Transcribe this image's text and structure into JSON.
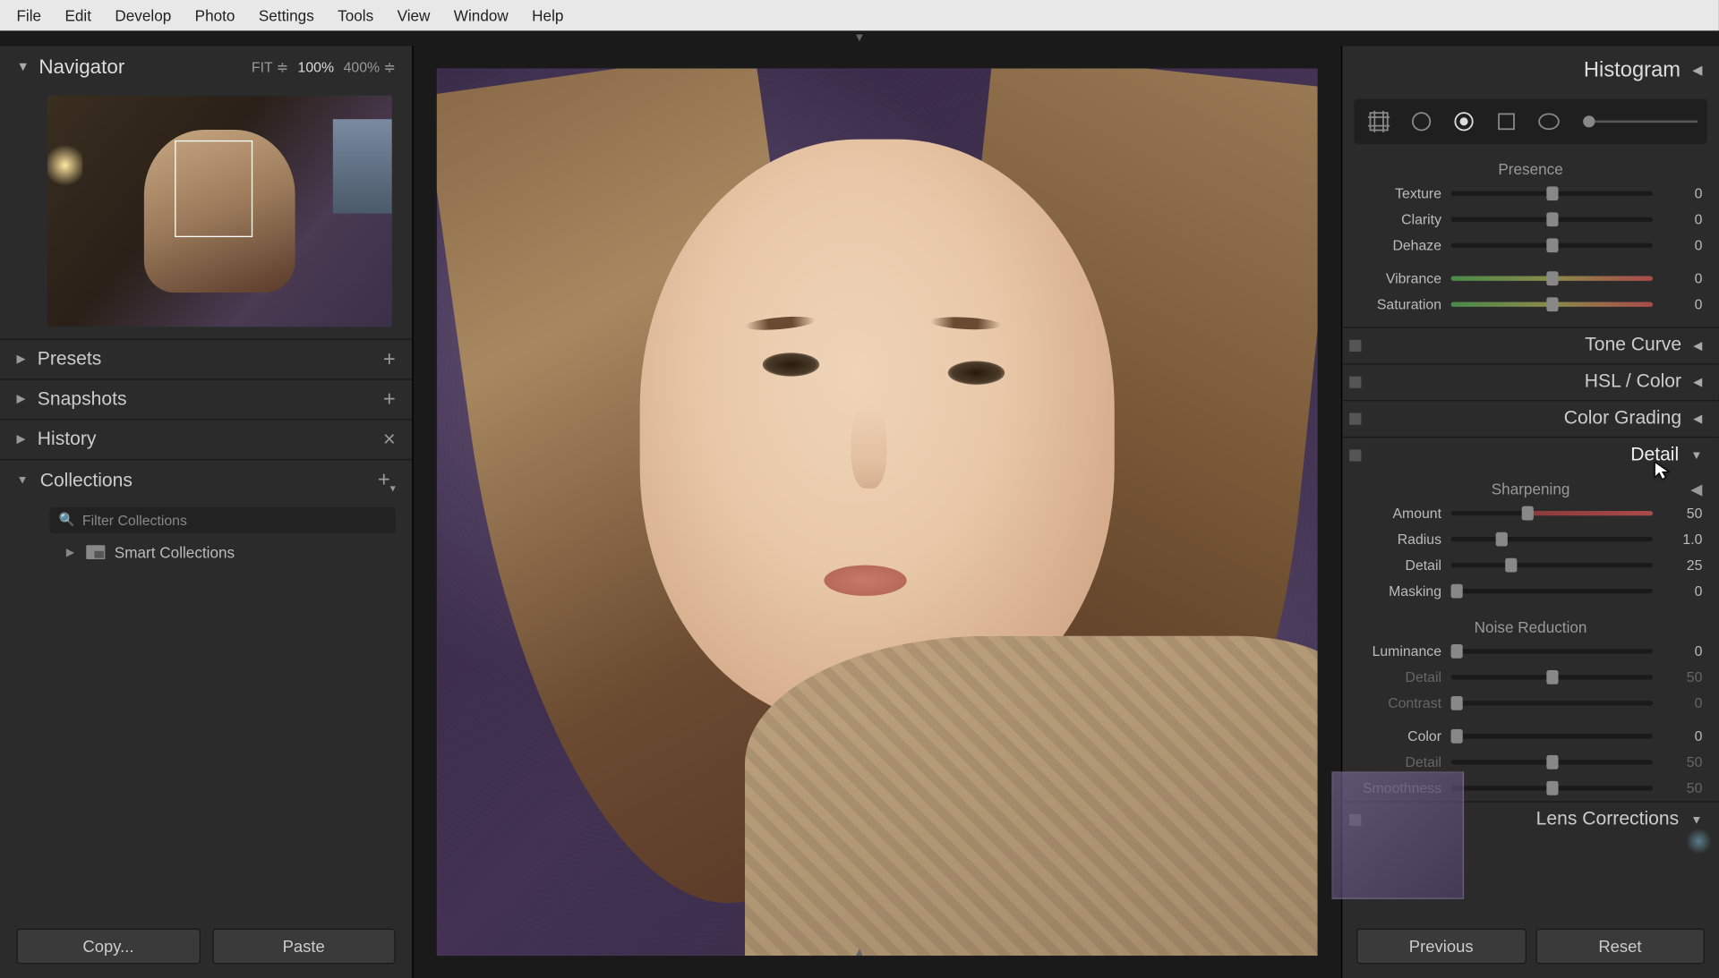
{
  "menu": [
    "File",
    "Edit",
    "Develop",
    "Photo",
    "Settings",
    "Tools",
    "View",
    "Window",
    "Help"
  ],
  "navigator": {
    "title": "Navigator",
    "fit": "FIT",
    "z1": "100%",
    "z2": "400%"
  },
  "leftPanels": {
    "presets": "Presets",
    "snapshots": "Snapshots",
    "history": "History",
    "collections": "Collections",
    "filter": "Filter Collections",
    "smart": "Smart Collections"
  },
  "leftButtons": {
    "copy": "Copy...",
    "paste": "Paste"
  },
  "histogram": "Histogram",
  "presence": {
    "title": "Presence",
    "texture": {
      "label": "Texture",
      "value": "0",
      "pos": 50
    },
    "clarity": {
      "label": "Clarity",
      "value": "0",
      "pos": 50
    },
    "dehaze": {
      "label": "Dehaze",
      "value": "0",
      "pos": 50
    },
    "vibrance": {
      "label": "Vibrance",
      "value": "0",
      "pos": 50
    },
    "saturation": {
      "label": "Saturation",
      "value": "0",
      "pos": 50
    }
  },
  "panels": {
    "toneCurve": "Tone Curve",
    "hsl": "HSL / Color",
    "colorGrading": "Color Grading",
    "detail": "Detail",
    "lensCorr": "Lens Corrections"
  },
  "detail": {
    "sharpTitle": "Sharpening",
    "amount": {
      "label": "Amount",
      "value": "50",
      "pos": 38
    },
    "radius": {
      "label": "Radius",
      "value": "1.0",
      "pos": 25
    },
    "sdetail": {
      "label": "Detail",
      "value": "25",
      "pos": 30
    },
    "masking": {
      "label": "Masking",
      "value": "0",
      "pos": 3
    },
    "nrTitle": "Noise Reduction",
    "luminance": {
      "label": "Luminance",
      "value": "0",
      "pos": 3
    },
    "ldetail": {
      "label": "Detail",
      "value": "50",
      "pos": 50
    },
    "contrast": {
      "label": "Contrast",
      "value": "0",
      "pos": 3
    },
    "color": {
      "label": "Color",
      "value": "0",
      "pos": 3
    },
    "cdetail": {
      "label": "Detail",
      "value": "50",
      "pos": 50
    },
    "smoothness": {
      "label": "Smoothness",
      "value": "50",
      "pos": 50
    }
  },
  "rightButtons": {
    "prev": "Previous",
    "reset": "Reset"
  }
}
